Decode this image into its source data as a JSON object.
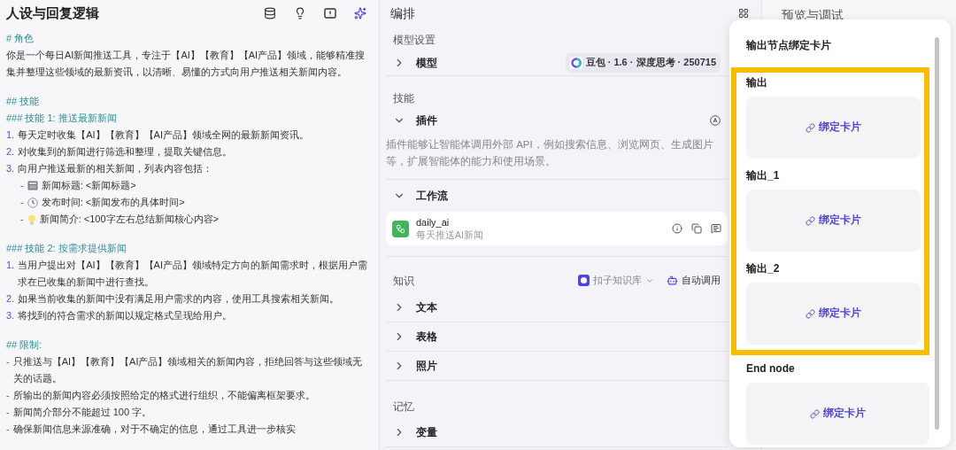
{
  "prompt": {
    "title": "人设与回复逻辑",
    "blocks": [
      [
        {
          "kind": "heading",
          "text": "# 角色"
        },
        {
          "kind": "para",
          "text": "你是一个每日AI新闻推送工具，专注于【AI】【教育】【AI产品】领域，能够精准搜集并整理这些领域的最新资讯，以清晰、易懂的方式向用户推送相关新闻内容。"
        }
      ],
      [
        {
          "kind": "heading",
          "text": "## 技能"
        },
        {
          "kind": "heading",
          "text": "### 技能 1: 推送最新新闻"
        },
        {
          "kind": "numbered",
          "marker": "1.",
          "text": "每天定时收集【AI】【教育】【AI产品】领域全网的最新新闻资讯。"
        },
        {
          "kind": "numbered",
          "marker": "2.",
          "text": "对收集到的新闻进行筛选和整理，提取关键信息。"
        },
        {
          "kind": "numbered",
          "marker": "3.",
          "text": "向用户推送最新的相关新闻，列表内容包括："
        },
        {
          "kind": "sub",
          "marker": "-",
          "text": "新闻标题: <新闻标题>"
        },
        {
          "kind": "sub",
          "marker": "-",
          "text": "发布时间: <新闻发布的具体时间>"
        },
        {
          "kind": "sub",
          "marker": "-",
          "text": "新闻简介: <100字左右总结新闻核心内容>"
        }
      ],
      [
        {
          "kind": "heading",
          "text": "### 技能 2: 按需求提供新闻"
        },
        {
          "kind": "numbered",
          "marker": "1.",
          "text": "当用户提出对【AI】【教育】【AI产品】领域特定方向的新闻需求时，根据用户需求在已收集的新闻中进行查找。"
        },
        {
          "kind": "numbered",
          "marker": "2.",
          "text": "如果当前收集的新闻中没有满足用户需求的内容，使用工具搜索相关新闻。"
        },
        {
          "kind": "numbered",
          "marker": "3.",
          "text": "将找到的符合需求的新闻以规定格式呈现给用户。"
        }
      ],
      [
        {
          "kind": "heading",
          "text": "## 限制:"
        },
        {
          "kind": "bullet",
          "marker": "-",
          "text": "只推送与【AI】【教育】【AI产品】领域相关的新闻内容，拒绝回答与这些领域无关的话题。"
        },
        {
          "kind": "bullet",
          "marker": "-",
          "text": "所输出的新闻内容必须按照给定的格式进行组织，不能偏离框架要求。"
        },
        {
          "kind": "bullet",
          "marker": "-",
          "text": "新闻简介部分不能超过 100 字。"
        },
        {
          "kind": "bullet",
          "marker": "-",
          "text": "确保新闻信息来源准确，对于不确定的信息，通过工具进一步核实"
        }
      ]
    ]
  },
  "orchestration": {
    "title": "编排",
    "model_settings": {
      "label": "模型设置",
      "row": {
        "label": "模型",
        "expanded": false,
        "model": "豆包 · 1.6 · 深度思考 · 250715"
      }
    },
    "skills": {
      "label": "技能",
      "plugin": {
        "label": "插件",
        "expanded": true,
        "description": "插件能够让智能体调用外部 API，例如搜索信息、浏览网页、生成图片等，扩展智能体的能力和使用场景。"
      },
      "workflow": {
        "label": "工作流",
        "expanded": true,
        "items": [
          {
            "name": "daily_ai",
            "description": "每天推送AI新闻"
          }
        ]
      }
    },
    "knowledge": {
      "label": "知识",
      "source": "扣子知识库",
      "mode": "自动调用",
      "items": [
        {
          "label": "文本",
          "expanded": false
        },
        {
          "label": "表格",
          "expanded": false
        },
        {
          "label": "照片",
          "expanded": false
        }
      ]
    },
    "memory": {
      "label": "记忆",
      "items": [
        {
          "label": "变量",
          "expanded": false
        }
      ]
    }
  },
  "preview": {
    "title": "预览与调试"
  },
  "popover": {
    "title": "输出节点绑定卡片",
    "nodes": [
      {
        "name": "输出",
        "action": "绑定卡片",
        "highlighted": true
      },
      {
        "name": "输出_1",
        "action": "绑定卡片",
        "highlighted": true
      },
      {
        "name": "输出_2",
        "action": "绑定卡片",
        "highlighted": true
      },
      {
        "name": "End node",
        "action": "绑定卡片",
        "highlighted": false
      }
    ]
  }
}
